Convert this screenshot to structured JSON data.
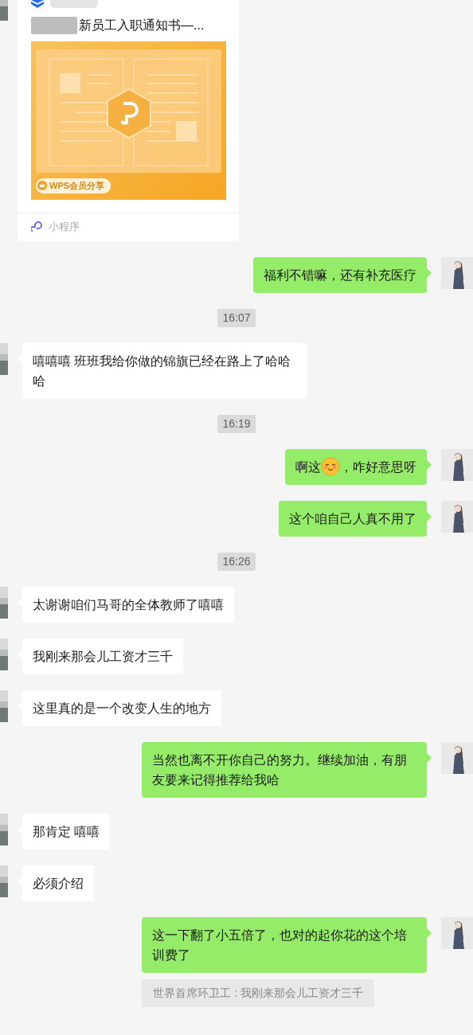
{
  "messages": [
    {
      "kind": "card",
      "outgoing": false,
      "title": "新员工入职通知书—...",
      "badge": "WPS会员分享",
      "footer": "小程序"
    },
    {
      "kind": "text",
      "outgoing": true,
      "parts": [
        {
          "kind": "text",
          "text": "福利不错嘛，还有补充医疗"
        }
      ]
    },
    {
      "kind": "time",
      "text": "16:07"
    },
    {
      "kind": "text",
      "outgoing": false,
      "parts": [
        {
          "kind": "text",
          "text": "嘻嘻嘻 班班我给你做的锦旗已经在路上了哈哈哈"
        }
      ]
    },
    {
      "kind": "time",
      "text": "16:19"
    },
    {
      "kind": "text",
      "outgoing": true,
      "parts": [
        {
          "kind": "text",
          "text": "啊这"
        },
        {
          "kind": "emoji"
        },
        {
          "kind": "text",
          "text": "，咋好意思呀"
        }
      ]
    },
    {
      "kind": "text",
      "outgoing": true,
      "parts": [
        {
          "kind": "text",
          "text": "这个咱自己人真不用了"
        }
      ]
    },
    {
      "kind": "time",
      "text": "16:26"
    },
    {
      "kind": "text",
      "outgoing": false,
      "parts": [
        {
          "kind": "text",
          "text": "太谢谢咱们马哥的全体教师了嘻嘻"
        }
      ]
    },
    {
      "kind": "text",
      "outgoing": false,
      "parts": [
        {
          "kind": "text",
          "text": "我刚来那会儿工资才三千"
        }
      ]
    },
    {
      "kind": "text",
      "outgoing": false,
      "parts": [
        {
          "kind": "text",
          "text": "这里真的是一个改变人生的地方"
        }
      ]
    },
    {
      "kind": "text",
      "outgoing": true,
      "parts": [
        {
          "kind": "text",
          "text": "当然也离不开你自己的努力。继续加油，有朋友要来记得推荐给我哈"
        }
      ]
    },
    {
      "kind": "text",
      "outgoing": false,
      "parts": [
        {
          "kind": "text",
          "text": "那肯定 嘻嘻"
        }
      ]
    },
    {
      "kind": "text",
      "outgoing": false,
      "parts": [
        {
          "kind": "text",
          "text": "必须介绍"
        }
      ]
    },
    {
      "kind": "text",
      "outgoing": true,
      "parts": [
        {
          "kind": "text",
          "text": "这一下翻了小五倍了，也对的起你花的这个培训费了"
        }
      ],
      "quote": "世界首席环卫工 : 我刚来那会儿工资才三千"
    }
  ]
}
